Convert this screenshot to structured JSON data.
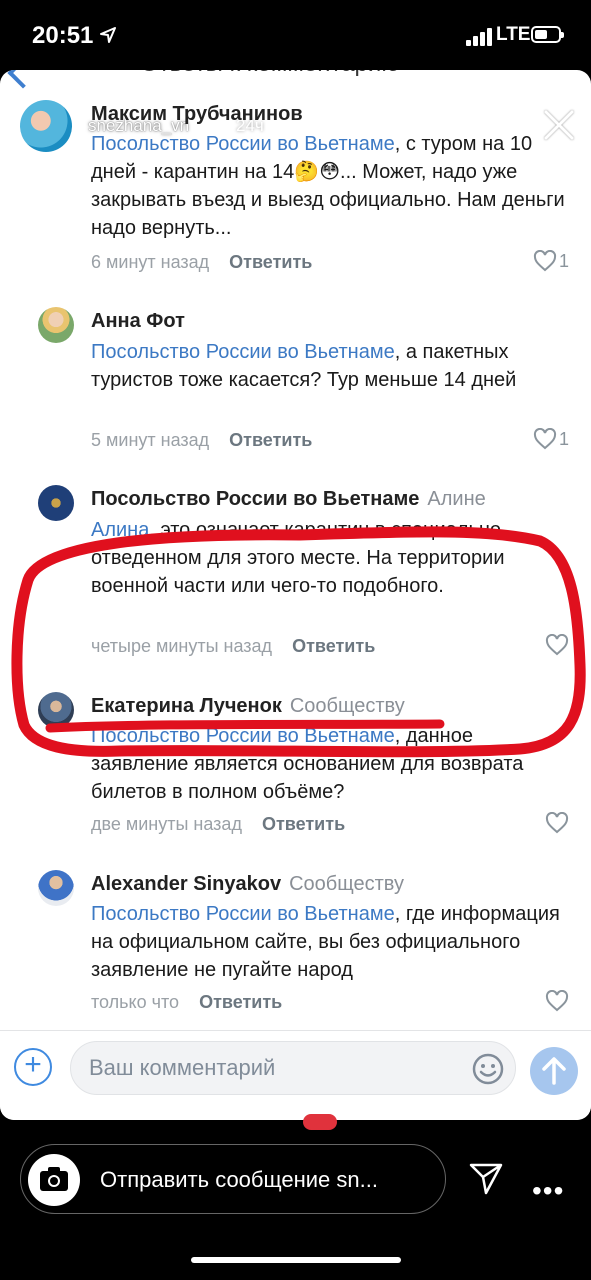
{
  "status": {
    "time": "20:51",
    "network": "LTE"
  },
  "header": {
    "ghost_title": "Ответы к комментарию"
  },
  "story": {
    "username": "snezhana_vn",
    "age": "24ч"
  },
  "comments": [
    {
      "author": "Максим Трубчанинов",
      "author_tail": "",
      "mention": "Посольство России во Вьетнаме",
      "text": ", с туром на 10 дней - карантин на 14🤔😳... Может, надо уже закрывать въезд и выезд официально. Нам деньги надо вернуть...",
      "time": "6 минут назад",
      "reply": "Ответить",
      "likes": "1"
    },
    {
      "author": "Анна Фот",
      "author_tail": "",
      "mention": "Посольство России во Вьетнаме",
      "text": ", а пакетных туристов тоже касается? Тур меньше 14 дней",
      "time": "5 минут назад",
      "reply": "Ответить",
      "likes": "1"
    },
    {
      "author": "Посольство России во Вьетнаме",
      "author_tail": "Алине",
      "mention": "Алина",
      "text": ", это означает карантин в специально отведенном для этого месте. На территории военной части или чего-то подобного.",
      "time": "четыре минуты назад",
      "reply": "Ответить",
      "likes": ""
    },
    {
      "author": "Екатерина Лученок",
      "author_tail": "Сообществу",
      "mention": "Посольство России во Вьетнаме",
      "text": ", данное заявление является основанием для возврата билетов в полном объёме?",
      "time": "две минуты назад",
      "reply": "Ответить",
      "likes": ""
    },
    {
      "author": "Alexander Sinyakov",
      "author_tail": "Сообществу",
      "mention": "Посольство России во Вьетнаме",
      "text": ", где информация на официальном сайте, вы без официального заявление не пугайте народ",
      "time": "только что",
      "reply": "Ответить",
      "likes": ""
    }
  ],
  "composer": {
    "placeholder": "Ваш комментарий"
  },
  "story_reply": {
    "placeholder": "Отправить сообщение sn..."
  },
  "colors": {
    "link": "#3c79c4",
    "annotation": "#e0101e",
    "send": "#a6c6ee"
  }
}
